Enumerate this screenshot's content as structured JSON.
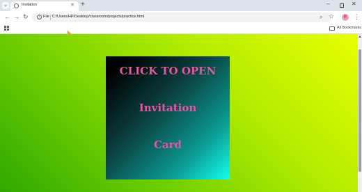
{
  "tab": {
    "title": "Invitation"
  },
  "omnibox": {
    "scheme_label": "File",
    "url": "C:/Users/HP/Desktop/classroom/projects/practice.html"
  },
  "bookmarks": {
    "all_label": "All Bookmarks"
  },
  "profile": {
    "initial": "R"
  },
  "card": {
    "line1": "CLICK TO OPEN",
    "line2": "Invitation",
    "line3": "Card"
  },
  "colors": {
    "card_text": "#e158a2",
    "gradient_top_right": "#e8ff00",
    "gradient_bottom_left": "#2fa800",
    "card_gradient_start": "#000000",
    "card_gradient_end": "#14fff0"
  },
  "icons": {
    "tab_search": "chevron-down-icon",
    "favicon": "globe-icon",
    "tab_close": "close-icon",
    "new_tab": "plus-icon",
    "back": "arrow-left-icon",
    "forward": "arrow-right-icon",
    "reload": "reload-icon",
    "site_info": "info-icon",
    "zoom": "zoom-icon",
    "bookmark": "star-icon",
    "menu": "kebab-menu-icon",
    "apps": "apps-grid-icon",
    "folder": "folder-icon"
  }
}
